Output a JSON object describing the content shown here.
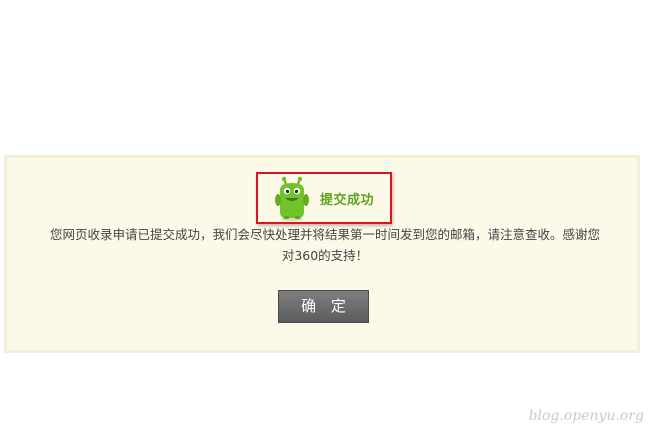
{
  "status": {
    "title": "提交成功",
    "message": "您网页收录申请已提交成功，我们会尽快处理并将结果第一时间发到您的邮箱，请注意查收。感谢您对360的支持！"
  },
  "actions": {
    "confirm_label": "确 定"
  },
  "watermark": "blog.openyu.org",
  "icons": {
    "mascot": "green-monster-mascot-icon"
  },
  "colors": {
    "panel_bg": "#fcf9e9",
    "highlight_border": "#d8141c",
    "success_text": "#5aa51e",
    "button_bg": "#6a6a6a"
  }
}
